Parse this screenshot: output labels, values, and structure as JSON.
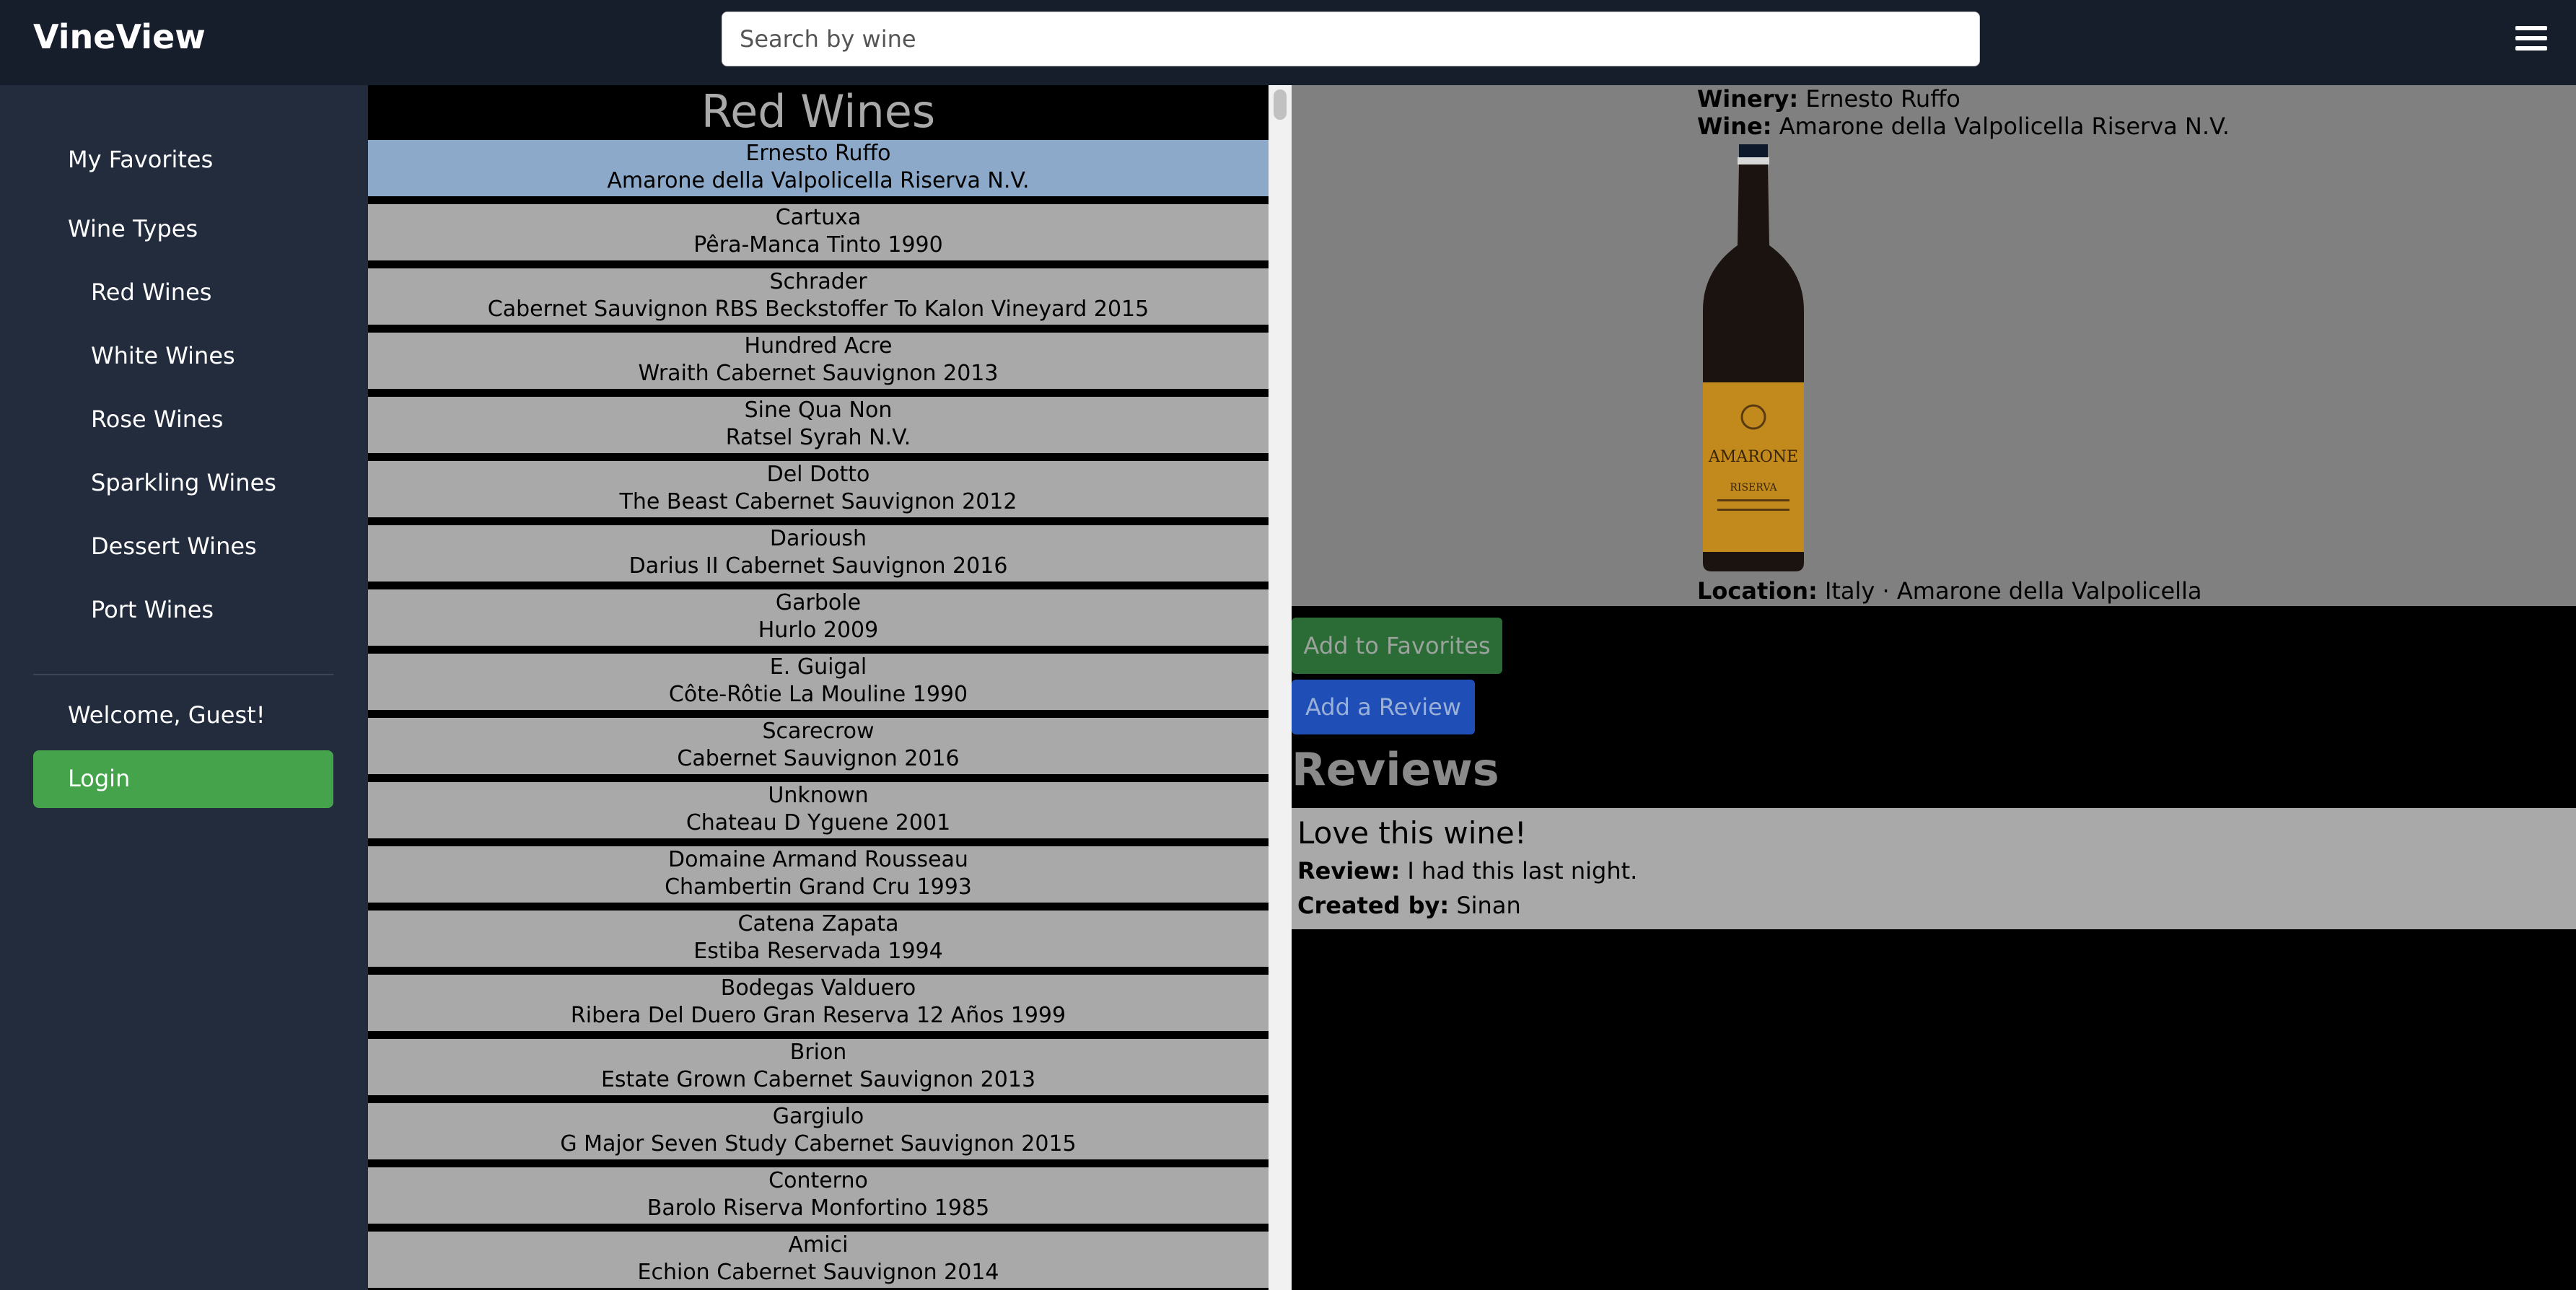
{
  "app": {
    "brand": "VineView"
  },
  "search": {
    "placeholder": "Search by wine"
  },
  "sidebar": {
    "favorites": "My Favorites",
    "wine_types": "Wine Types",
    "types": [
      "Red Wines",
      "White Wines",
      "Rose Wines",
      "Sparkling Wines",
      "Dessert Wines",
      "Port Wines"
    ],
    "welcome": "Welcome, Guest!",
    "login": "Login"
  },
  "list": {
    "title": "Red Wines",
    "items": [
      {
        "winery": "Ernesto Ruffo",
        "wine": "Amarone della Valpolicella Riserva N.V."
      },
      {
        "winery": "Cartuxa",
        "wine": "Pêra-Manca Tinto 1990"
      },
      {
        "winery": "Schrader",
        "wine": "Cabernet Sauvignon RBS Beckstoffer To Kalon Vineyard 2015"
      },
      {
        "winery": "Hundred Acre",
        "wine": "Wraith Cabernet Sauvignon 2013"
      },
      {
        "winery": "Sine Qua Non",
        "wine": "Ratsel Syrah N.V."
      },
      {
        "winery": "Del Dotto",
        "wine": "The Beast Cabernet Sauvignon 2012"
      },
      {
        "winery": "Darioush",
        "wine": "Darius II Cabernet Sauvignon 2016"
      },
      {
        "winery": "Garbole",
        "wine": "Hurlo 2009"
      },
      {
        "winery": "E. Guigal",
        "wine": "Côte-Rôtie La Mouline 1990"
      },
      {
        "winery": "Scarecrow",
        "wine": "Cabernet Sauvignon 2016"
      },
      {
        "winery": "Unknown",
        "wine": "Chateau D Yguene 2001"
      },
      {
        "winery": "Domaine Armand Rousseau",
        "wine": "Chambertin Grand Cru 1993"
      },
      {
        "winery": "Catena Zapata",
        "wine": "Estiba Reservada 1994"
      },
      {
        "winery": "Bodegas Valduero",
        "wine": "Ribera Del Duero Gran Reserva 12 Años 1999"
      },
      {
        "winery": "Brion",
        "wine": "Estate Grown Cabernet Sauvignon 2013"
      },
      {
        "winery": "Gargiulo",
        "wine": "G Major Seven Study Cabernet Sauvignon 2015"
      },
      {
        "winery": "Conterno",
        "wine": "Barolo Riserva Monfortino 1985"
      },
      {
        "winery": "Amici",
        "wine": "Echion Cabernet Sauvignon 2014"
      }
    ]
  },
  "detail": {
    "winery_label": "Winery:",
    "winery": "Ernesto Ruffo",
    "wine_label": "Wine:",
    "wine": "Amarone della Valpolicella Riserva N.V.",
    "location_label": "Location:",
    "location": "Italy · Amarone della Valpolicella",
    "bottle_label": "AMARONE",
    "bottle_sub": "RISERVA"
  },
  "actions": {
    "favorites": "Add to Favorites",
    "review": "Add a Review"
  },
  "reviews": {
    "heading": "Reviews",
    "items": [
      {
        "title": "Love this wine!",
        "review_label": "Review:",
        "review": "I had this last night.",
        "created_label": "Created by:",
        "created_by": "Sinan"
      }
    ]
  },
  "colors": {
    "topbar": "#161d2b",
    "sidebar": "#222c3d",
    "login": "#45a34b",
    "list_item": "#a9a9a9",
    "selected": "#8da9c9",
    "fav_button": "#2a6b36",
    "review_button": "#1f4fb6"
  }
}
